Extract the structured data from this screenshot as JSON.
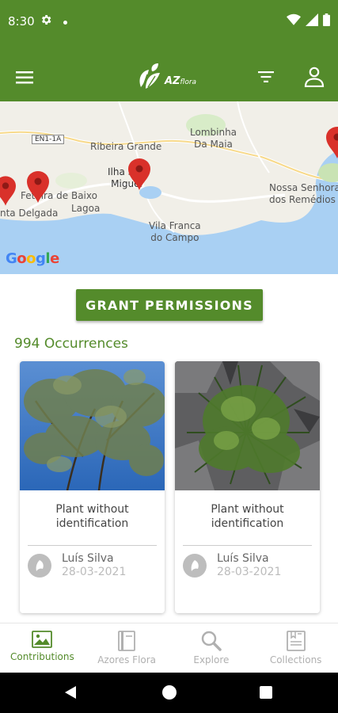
{
  "status_bar": {
    "time": "8:30"
  },
  "app": {
    "logo_main": "AZ",
    "logo_sub": "flora"
  },
  "map": {
    "labels": {
      "lombinha": "Lombinha\nDa Maia",
      "ribeira_grande": "Ribeira Grande",
      "ilha_sao_miguel": "Ilha São\nMiguel",
      "ponta_delgada": "nta Delgada",
      "feteira": "Feteira de Baixo",
      "lagoa": "Lagoa",
      "nossa_senhora": "Nossa Senhora\ndos Remédios",
      "vila_franca": "Vila Franca\ndo Campo",
      "road_sign": "EN1-1A"
    },
    "attribution": "Google"
  },
  "grant_button": "GRANT PERMISSIONS",
  "occurrences": "994 Occurrences",
  "cards": [
    {
      "title": "Plant without identification",
      "user": "Luís Silva",
      "date": "28-03-2021"
    },
    {
      "title": "Plant without identification",
      "user": "Luís Silva",
      "date": "28-03-2021"
    }
  ],
  "bottom_nav": [
    {
      "label": "Contributions",
      "icon": "image-icon",
      "active": true
    },
    {
      "label": "Azores Flora",
      "icon": "book-icon",
      "active": false
    },
    {
      "label": "Explore",
      "icon": "search-icon",
      "active": false
    },
    {
      "label": "Collections",
      "icon": "collections-icon",
      "active": false
    }
  ],
  "colors": {
    "primary": "#548b2b",
    "map_water": "#a9d0f3",
    "map_land": "#f1efe8",
    "pin": "#d9312a"
  }
}
